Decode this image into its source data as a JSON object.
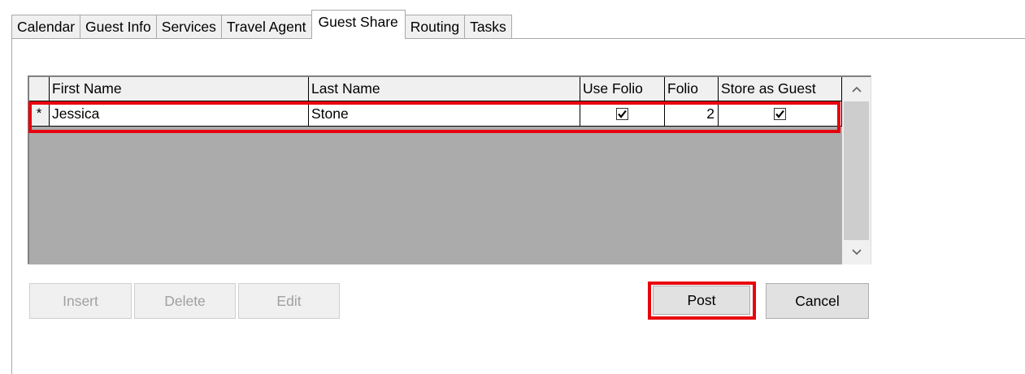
{
  "tabs": [
    {
      "label": "Calendar",
      "active": false
    },
    {
      "label": "Guest Info",
      "active": false
    },
    {
      "label": "Services",
      "active": false
    },
    {
      "label": "Travel Agent",
      "active": false
    },
    {
      "label": "Guest Share",
      "active": true
    },
    {
      "label": "Routing",
      "active": false
    },
    {
      "label": "Tasks",
      "active": false
    }
  ],
  "grid": {
    "columns": [
      "First Name",
      "Last Name",
      "Use Folio",
      "Folio",
      "Store as Guest"
    ],
    "rows": [
      {
        "indicator": "*",
        "first_name": "Jessica",
        "last_name": "Stone",
        "use_folio": true,
        "folio": "2",
        "store_as_guest": true
      }
    ]
  },
  "buttons": {
    "insert": "Insert",
    "delete": "Delete",
    "edit": "Edit",
    "post": "Post",
    "cancel": "Cancel"
  },
  "colors": {
    "highlight": "#e8000e",
    "grid_background": "#ababab"
  }
}
